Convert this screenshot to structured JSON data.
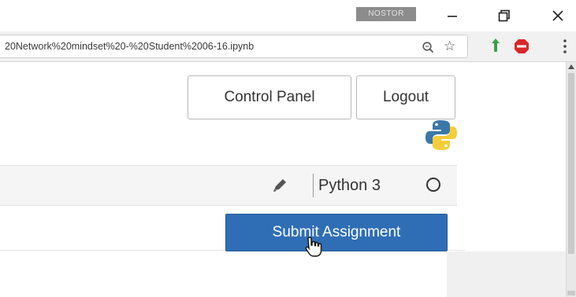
{
  "window": {
    "profile_badge": "NOSTOR",
    "controls": [
      "minimize",
      "restore",
      "close"
    ]
  },
  "address_bar": {
    "url": "20Network%20mindset%20-%20Student%2006-16.ipynb",
    "icons": [
      "zoom-icon",
      "bookmark-star-icon",
      "extension-icon",
      "adblock-icon",
      "menu-icon"
    ]
  },
  "header": {
    "control_panel_label": "Control Panel",
    "logout_label": "Logout"
  },
  "kernel": {
    "name": "Python 3"
  },
  "assignment": {
    "submit_label": "Submit Assignment"
  },
  "colors": {
    "submit_bg": "#2f6eb5",
    "python_blue": "#3b77a8",
    "python_yellow": "#f5cd3a"
  }
}
